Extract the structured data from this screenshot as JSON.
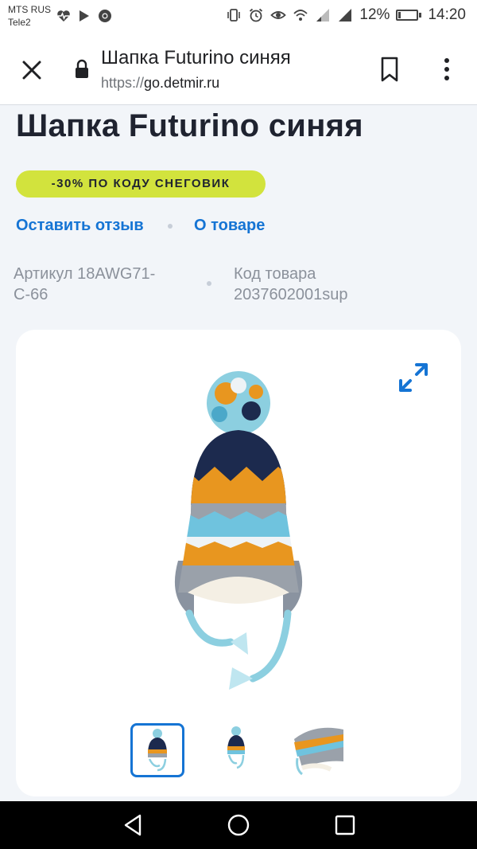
{
  "status_bar": {
    "carrier_1": "MTS RUS",
    "carrier_2": "Tele2",
    "battery_percent": "12%",
    "battery_level": 0.12,
    "time": "14:20",
    "icons": [
      "heart-rate-icon",
      "play-store-icon",
      "chrome-icon",
      "vibrate-icon",
      "alarm-icon",
      "eye-comfort-icon",
      "wifi-icon",
      "signal-icon",
      "signal-icon",
      "battery-icon"
    ]
  },
  "browser": {
    "page_title": "Шапка Futurino синяя",
    "url_scheme": "https://",
    "url_host": "go.detmir.ru",
    "icons": [
      "close-icon",
      "lock-icon",
      "bookmark-icon",
      "more-vert-icon"
    ]
  },
  "product": {
    "title": "Шапка Futurino синяя",
    "promo": "-30% ПО КОДУ СНЕГОВИК",
    "link_review": "Оставить отзыв",
    "link_about": "О товаре",
    "article": "Артикул 18AWG71-С-66",
    "code": "Код товара 2037602001sup"
  },
  "gallery": {
    "thumbnails_count": 3,
    "selected_index": 0,
    "icons": [
      "expand-icon"
    ]
  },
  "colors": {
    "accent_blue": "#1574d4",
    "promo_bg": "#d2e33d",
    "page_bg": "#f2f5f9",
    "card_bg": "#ffffff",
    "hat_navy": "#1c2a4e",
    "hat_orange": "#e8961f",
    "hat_sky": "#8ccfe0"
  },
  "nav_bar": {
    "icons": [
      "back-icon",
      "home-icon",
      "recent-apps-icon"
    ]
  }
}
